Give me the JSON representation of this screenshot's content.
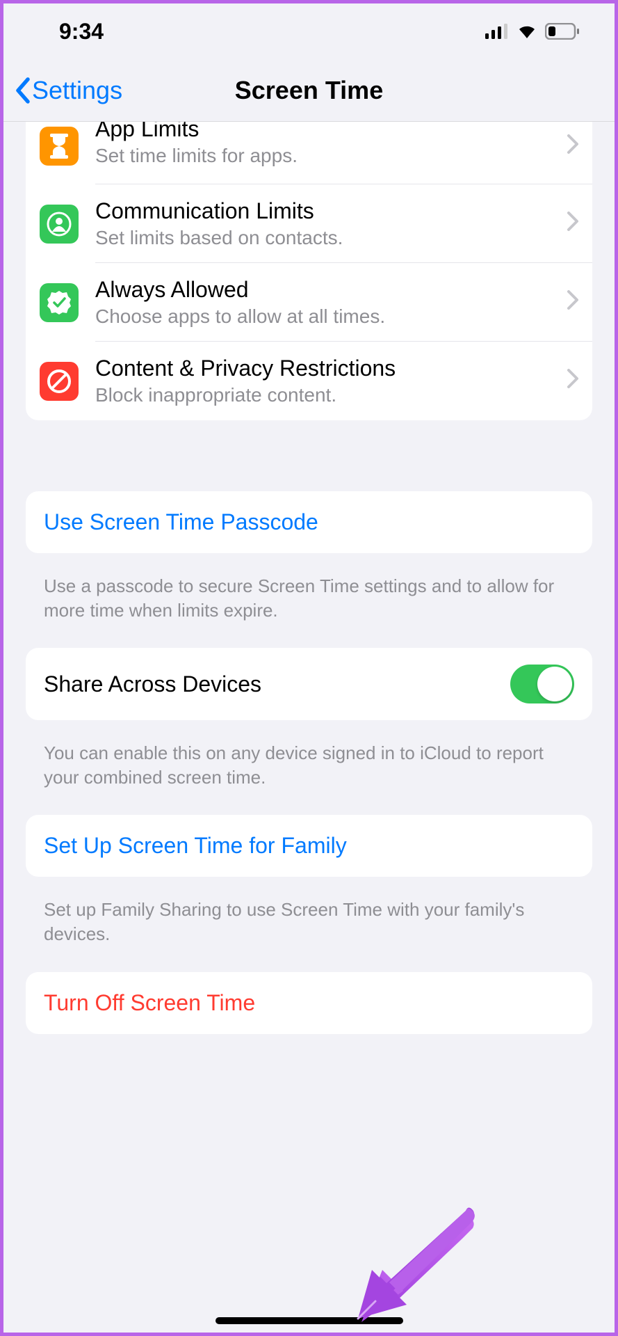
{
  "status": {
    "time": "9:34"
  },
  "nav": {
    "back_label": "Settings",
    "title": "Screen Time"
  },
  "options": [
    {
      "title": "App Limits",
      "subtitle": "Set time limits for apps."
    },
    {
      "title": "Communication Limits",
      "subtitle": "Set limits based on contacts."
    },
    {
      "title": "Always Allowed",
      "subtitle": "Choose apps to allow at all times."
    },
    {
      "title": "Content & Privacy Restrictions",
      "subtitle": "Block inappropriate content."
    }
  ],
  "passcode": {
    "label": "Use Screen Time Passcode",
    "footer": "Use a passcode to secure Screen Time settings and to allow for more time when limits expire."
  },
  "share": {
    "label": "Share Across Devices",
    "enabled": true,
    "footer": "You can enable this on any device signed in to iCloud to report your combined screen time."
  },
  "family": {
    "label": "Set Up Screen Time for Family",
    "footer": "Set up Family Sharing to use Screen Time with your family's devices."
  },
  "turnoff": {
    "label": "Turn Off Screen Time"
  }
}
